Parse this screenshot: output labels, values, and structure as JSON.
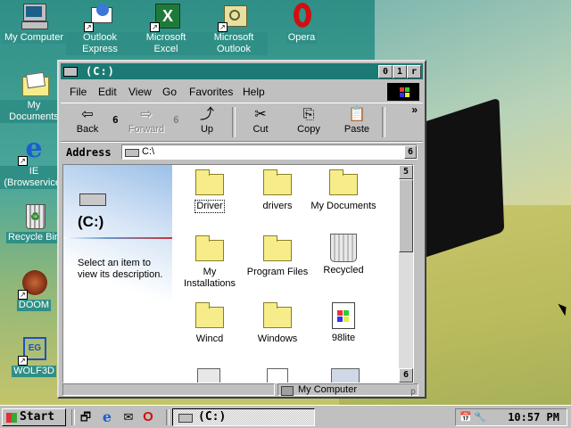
{
  "desktop": {
    "icons": [
      {
        "label": "My Computer",
        "icon": "my-computer-icon"
      },
      {
        "label": "Outlook Express",
        "icon": "outlook-express-icon"
      },
      {
        "label": "Microsoft Excel",
        "icon": "excel-icon"
      },
      {
        "label": "Microsoft Outlook",
        "icon": "outlook-icon"
      },
      {
        "label": "Opera",
        "icon": "opera-icon"
      },
      {
        "label": "My Documents",
        "icon": "my-documents-icon"
      },
      {
        "label": "IE (Browservice)",
        "icon": "internet-explorer-icon"
      },
      {
        "label": "Recycle Bin",
        "icon": "recycle-bin-icon"
      },
      {
        "label": "DOOM",
        "icon": "doom-icon"
      },
      {
        "label": "WOLF3D",
        "icon": "wolf3d-icon"
      }
    ],
    "wallpaper_colors": {
      "teal": "#2f8f86",
      "olive": "#c4c46a"
    }
  },
  "window": {
    "title": "(C:)",
    "title_color": "#1b7b74",
    "controls": {
      "minimize": "0",
      "maximize": "1",
      "close": "r"
    },
    "menu": [
      "File",
      "Edit",
      "View",
      "Go",
      "Favorites",
      "Help"
    ],
    "toolbar": {
      "back": "Back",
      "back_arrow": "6",
      "forward": "Forward",
      "forward_arrow": "6",
      "up": "Up",
      "cut": "Cut",
      "copy": "Copy",
      "paste": "Paste",
      "more": "»"
    },
    "address": {
      "label": "Address",
      "value": "C:\\",
      "dropdown": "6"
    },
    "webview": {
      "title": "(C:)",
      "description": "Select an item to view its description."
    },
    "files": [
      {
        "name": "Driver",
        "type": "folder"
      },
      {
        "name": "drivers",
        "type": "folder"
      },
      {
        "name": "My Documents",
        "type": "folder"
      },
      {
        "name": "My Installations",
        "type": "folder"
      },
      {
        "name": "Program Files",
        "type": "folder"
      },
      {
        "name": "Recycled",
        "type": "recycle"
      },
      {
        "name": "Wincd",
        "type": "folder"
      },
      {
        "name": "Windows",
        "type": "folder"
      },
      {
        "name": "98lite",
        "type": "file"
      }
    ],
    "scroll": {
      "up": "5",
      "down": "6"
    },
    "status": {
      "location": "My Computer",
      "grip": "p"
    }
  },
  "taskbar": {
    "start": "Start",
    "task_label": "(C:)",
    "clock": "10:57 PM"
  }
}
